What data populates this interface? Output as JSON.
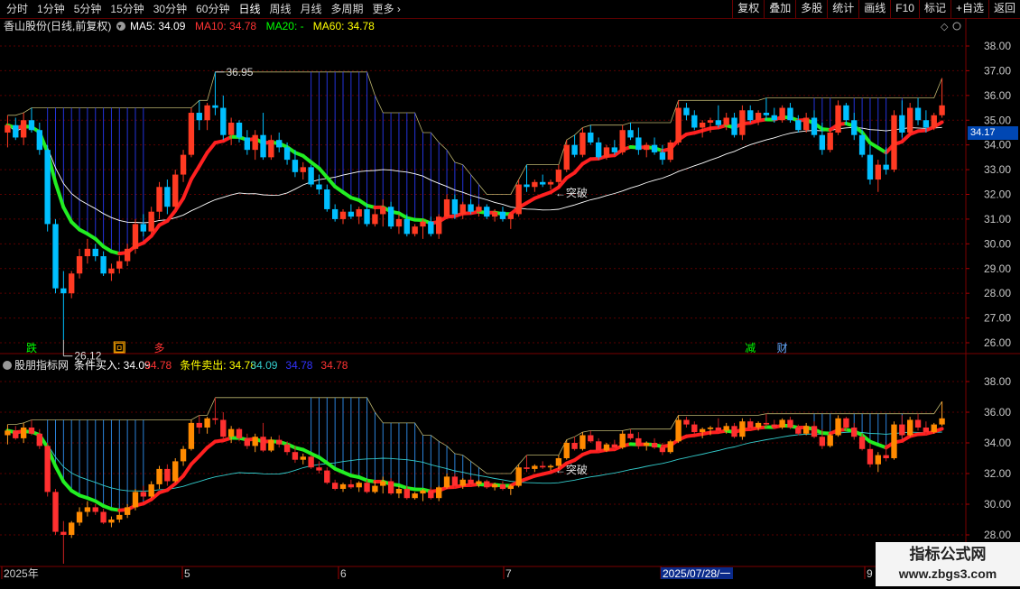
{
  "toolbar": {
    "period_tabs": [
      "分时",
      "1分钟",
      "5分钟",
      "15分钟",
      "30分钟",
      "60分钟",
      "日线",
      "周线",
      "月线",
      "多周期",
      "更多"
    ],
    "active_tab": "日线",
    "right_buttons": [
      "复权",
      "叠加",
      "多股",
      "统计",
      "画线",
      "F10",
      "标记",
      "+自选",
      "返回"
    ]
  },
  "main_panel": {
    "stock_title": "香山股份(日线,前复权)",
    "ma_labels": [
      {
        "text": "MA5: 34.09",
        "color": "#ffffff"
      },
      {
        "text": "MA10: 34.78",
        "color": "#ff3333"
      },
      {
        "text": "MA20: -",
        "color": "#00ff00"
      },
      {
        "text": "MA60: 34.78",
        "color": "#ffff00"
      }
    ],
    "y_ticks": [
      "38.00",
      "37.00",
      "36.00",
      "35.00",
      "34.00",
      "33.00",
      "32.00",
      "31.00",
      "30.00",
      "29.00",
      "28.00",
      "27.00",
      "26.00"
    ],
    "current_price": "34.17",
    "high_marker": "36.95",
    "low_marker": "26.12",
    "breakout_label": "突破",
    "signals": [
      {
        "text": "跌",
        "color": "#00ff00"
      },
      {
        "text": "回",
        "color": "#ffaa00"
      },
      {
        "text": "多",
        "color": "#ff3333"
      },
      {
        "text": "减",
        "color": "#00ff00"
      },
      {
        "text": "财",
        "color": "#66aaff"
      }
    ]
  },
  "sub_panel": {
    "indicator_name": "股朋指标网",
    "labels": [
      {
        "text": "条件买入: 34.09",
        "color": "#ffffff"
      },
      {
        "text": "34.78",
        "color": "#ff3333"
      },
      {
        "text": "条件卖出: 34.78",
        "color": "#ffff00"
      },
      {
        "text": "34.09",
        "color": "#33cccc"
      },
      {
        "text": "34.78",
        "color": "#3333ff"
      },
      {
        "text": "34.78",
        "color": "#ff3333"
      }
    ],
    "y_ticks": [
      "38.00",
      "36.00",
      "34.00",
      "32.00",
      "30.00",
      "28.00"
    ],
    "breakout_label": "突破"
  },
  "date_axis": {
    "labels": [
      "2025年",
      "5",
      "6",
      "7",
      "2025/07/28/一",
      "9"
    ]
  },
  "watermark": {
    "title": "指标公式网",
    "url": "www.zbgs3.com"
  },
  "chart_data": {
    "type": "candlestick",
    "ohlc": [
      [
        34.5,
        35.2,
        33.9,
        34.8
      ],
      [
        34.8,
        35.1,
        34.2,
        34.3
      ],
      [
        34.3,
        35.3,
        34.0,
        35.0
      ],
      [
        35.0,
        35.5,
        34.5,
        34.6
      ],
      [
        34.6,
        34.9,
        33.6,
        33.8
      ],
      [
        33.8,
        34.0,
        30.5,
        30.8
      ],
      [
        30.8,
        31.0,
        28.0,
        28.2
      ],
      [
        28.2,
        28.9,
        26.12,
        28.0
      ],
      [
        28.0,
        28.9,
        27.8,
        28.8
      ],
      [
        28.8,
        29.8,
        28.6,
        29.5
      ],
      [
        29.5,
        30.2,
        29.2,
        29.8
      ],
      [
        29.8,
        30.0,
        29.3,
        29.5
      ],
      [
        29.5,
        29.7,
        28.7,
        28.8
      ],
      [
        28.8,
        29.2,
        28.5,
        29.0
      ],
      [
        29.0,
        29.5,
        28.8,
        29.3
      ],
      [
        29.3,
        30.0,
        29.1,
        29.8
      ],
      [
        29.8,
        31.0,
        29.6,
        30.8
      ],
      [
        30.8,
        31.2,
        30.3,
        30.5
      ],
      [
        30.5,
        31.5,
        30.4,
        31.3
      ],
      [
        31.3,
        32.5,
        31.0,
        32.3
      ],
      [
        32.3,
        32.6,
        31.2,
        31.5
      ],
      [
        31.5,
        33.0,
        31.4,
        32.8
      ],
      [
        32.8,
        33.8,
        32.5,
        33.6
      ],
      [
        33.6,
        35.5,
        33.5,
        35.3
      ],
      [
        35.3,
        35.8,
        34.6,
        35.0
      ],
      [
        35.0,
        35.7,
        34.6,
        35.6
      ],
      [
        35.6,
        36.95,
        35.2,
        35.5
      ],
      [
        35.5,
        36.0,
        34.2,
        34.4
      ],
      [
        34.4,
        35.1,
        34.0,
        34.9
      ],
      [
        34.9,
        35.0,
        34.1,
        34.3
      ],
      [
        34.3,
        34.6,
        33.6,
        33.8
      ],
      [
        33.8,
        34.6,
        33.4,
        34.4
      ],
      [
        34.4,
        35.3,
        33.4,
        33.5
      ],
      [
        33.5,
        34.4,
        33.4,
        34.2
      ],
      [
        34.2,
        34.5,
        33.7,
        33.9
      ],
      [
        33.9,
        34.1,
        33.2,
        33.4
      ],
      [
        33.4,
        33.8,
        32.7,
        32.9
      ],
      [
        32.9,
        33.3,
        32.6,
        33.1
      ],
      [
        33.1,
        33.2,
        32.3,
        32.4
      ],
      [
        32.4,
        32.8,
        32.0,
        32.2
      ],
      [
        32.2,
        32.4,
        31.3,
        31.4
      ],
      [
        31.4,
        31.6,
        30.9,
        31.0
      ],
      [
        31.0,
        31.4,
        30.8,
        31.3
      ],
      [
        31.3,
        31.6,
        31.0,
        31.1
      ],
      [
        31.1,
        31.5,
        30.8,
        31.4
      ],
      [
        31.4,
        31.6,
        30.7,
        30.8
      ],
      [
        30.8,
        31.5,
        30.7,
        31.2
      ],
      [
        31.2,
        31.8,
        30.7,
        31.5
      ],
      [
        31.5,
        31.7,
        30.6,
        30.7
      ],
      [
        30.7,
        31.2,
        30.4,
        31.0
      ],
      [
        31.0,
        31.2,
        30.3,
        30.4
      ],
      [
        30.4,
        30.8,
        30.3,
        30.7
      ],
      [
        30.7,
        31.0,
        30.2,
        30.9
      ],
      [
        30.9,
        31.1,
        30.3,
        30.4
      ],
      [
        30.4,
        31.2,
        30.2,
        31.1
      ],
      [
        31.1,
        32.0,
        31.0,
        31.8
      ],
      [
        31.8,
        32.0,
        31.0,
        31.2
      ],
      [
        31.2,
        31.7,
        31.0,
        31.6
      ],
      [
        31.6,
        31.8,
        31.2,
        31.3
      ],
      [
        31.3,
        31.6,
        31.1,
        31.5
      ],
      [
        31.5,
        31.6,
        31.0,
        31.1
      ],
      [
        31.1,
        31.4,
        30.9,
        31.3
      ],
      [
        31.3,
        31.5,
        30.9,
        31.0
      ],
      [
        31.0,
        31.3,
        30.6,
        31.2
      ],
      [
        31.2,
        32.6,
        31.1,
        32.4
      ],
      [
        32.4,
        33.2,
        32.1,
        32.3
      ],
      [
        32.3,
        32.6,
        32.1,
        32.5
      ],
      [
        32.5,
        32.8,
        32.3,
        32.4
      ],
      [
        32.4,
        32.6,
        32.2,
        32.5
      ],
      [
        32.5,
        33.2,
        32.3,
        33.0
      ],
      [
        33.0,
        34.2,
        32.9,
        34.0
      ],
      [
        34.0,
        34.4,
        33.5,
        33.6
      ],
      [
        33.6,
        34.7,
        33.5,
        34.5
      ],
      [
        34.5,
        34.8,
        34.0,
        34.1
      ],
      [
        34.1,
        34.3,
        33.4,
        33.5
      ],
      [
        33.5,
        34.0,
        33.4,
        33.9
      ],
      [
        33.9,
        34.2,
        33.6,
        33.7
      ],
      [
        33.7,
        34.8,
        33.6,
        34.6
      ],
      [
        34.6,
        34.9,
        34.2,
        34.3
      ],
      [
        34.3,
        34.7,
        33.6,
        33.8
      ],
      [
        33.8,
        34.1,
        33.5,
        34.0
      ],
      [
        34.0,
        34.3,
        33.6,
        33.7
      ],
      [
        33.7,
        34.0,
        33.2,
        33.4
      ],
      [
        33.4,
        34.2,
        33.3,
        34.1
      ],
      [
        34.1,
        35.8,
        34.0,
        35.5
      ],
      [
        35.5,
        35.7,
        35.0,
        35.2
      ],
      [
        35.2,
        35.4,
        34.6,
        34.7
      ],
      [
        34.7,
        35.0,
        34.3,
        34.9
      ],
      [
        34.9,
        35.1,
        34.5,
        35.0
      ],
      [
        35.0,
        35.6,
        34.7,
        34.8
      ],
      [
        34.8,
        35.3,
        34.6,
        35.1
      ],
      [
        35.1,
        35.3,
        34.3,
        34.4
      ],
      [
        34.4,
        35.6,
        34.2,
        35.4
      ],
      [
        35.4,
        35.6,
        34.9,
        35.0
      ],
      [
        35.0,
        35.4,
        34.8,
        35.3
      ],
      [
        35.3,
        35.9,
        35.0,
        35.2
      ],
      [
        35.2,
        35.5,
        34.9,
        35.0
      ],
      [
        35.0,
        35.6,
        34.9,
        35.5
      ],
      [
        35.5,
        35.7,
        34.9,
        35.0
      ],
      [
        35.0,
        35.2,
        34.5,
        34.6
      ],
      [
        34.6,
        35.3,
        34.5,
        35.1
      ],
      [
        35.1,
        35.4,
        34.3,
        34.4
      ],
      [
        34.4,
        34.9,
        33.6,
        33.8
      ],
      [
        33.8,
        34.6,
        33.7,
        34.5
      ],
      [
        34.5,
        35.8,
        34.4,
        35.6
      ],
      [
        35.6,
        35.7,
        34.8,
        35.0
      ],
      [
        35.0,
        35.3,
        34.2,
        34.4
      ],
      [
        34.4,
        34.6,
        33.5,
        33.6
      ],
      [
        33.6,
        34.0,
        32.4,
        32.6
      ],
      [
        32.6,
        33.4,
        32.1,
        33.2
      ],
      [
        33.2,
        33.9,
        32.8,
        33.0
      ],
      [
        33.0,
        35.4,
        32.9,
        35.2
      ],
      [
        35.2,
        35.8,
        34.3,
        34.5
      ],
      [
        34.5,
        35.7,
        34.4,
        35.5
      ],
      [
        35.5,
        35.9,
        34.8,
        35.0
      ],
      [
        35.0,
        35.4,
        34.5,
        34.7
      ],
      [
        34.7,
        35.3,
        34.6,
        35.2
      ],
      [
        35.2,
        36.7,
        35.1,
        35.6
      ]
    ],
    "y_range_main": [
      26.0,
      38.0
    ],
    "y_range_sub": [
      28.0,
      38.0
    ],
    "up_color": "#ff3a22",
    "down_color": "#00bfff"
  }
}
